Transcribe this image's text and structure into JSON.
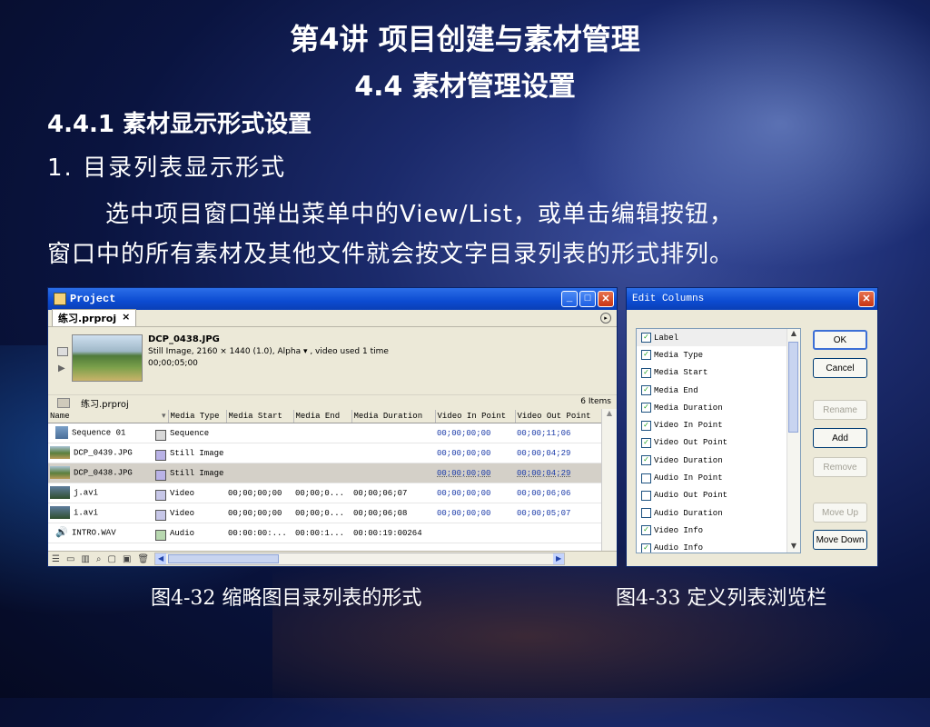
{
  "slide": {
    "title": "第4讲  项目创建与素材管理",
    "subtitle": "4.4 素材管理设置",
    "section": "4.4.1 素材显示形式设置",
    "item": "1. 目录列表显示形式",
    "paragraph_line1": "选中项目窗口弹出菜单中的View/List，或单击编辑按钮，",
    "paragraph_line2": "窗口中的所有素材及其他文件就会按文字目录列表的形式排列。",
    "caption_left": "图4-32 缩略图目录列表的形式",
    "caption_right": "图4-33 定义列表浏览栏"
  },
  "project_window": {
    "title": "Project",
    "tab_label": "练习.prproj",
    "tab_close": "×",
    "preview": {
      "name": "DCP_0438.JPG",
      "meta": "Still Image, 2160 × 1440 (1.0), Alpha  ▾  , video used 1 time",
      "duration": "00;00;05;00"
    },
    "folder_name": "练习.prproj",
    "item_count": "6 Items",
    "columns": [
      "Name",
      "Media Type",
      "Media Start",
      "Media End",
      "Media Duration",
      "Video In Point",
      "Video Out Point"
    ],
    "rows": [
      {
        "name": "Sequence 01",
        "icon": "sequence-icon",
        "label_color": "#d8d8d8",
        "type": "Sequence",
        "start": "",
        "end": "",
        "duration": "",
        "in": "00;00;00;00",
        "out": "00;00;11;06"
      },
      {
        "name": "DCP_0439.JPG",
        "icon": "photo-icon",
        "label_color": "#b9b2e6",
        "type": "Still Image",
        "start": "",
        "end": "",
        "duration": "",
        "in": "00;00;00;00",
        "out": "00;00;04;29"
      },
      {
        "name": "DCP_0438.JPG",
        "icon": "photo-icon",
        "label_color": "#b9b2e6",
        "type": "Still Image",
        "start": "",
        "end": "",
        "duration": "",
        "in": "00;00;00;00",
        "out": "00;00;04;29",
        "selected": true
      },
      {
        "name": "j.avi",
        "icon": "video-icon",
        "label_color": "#c7c7e8",
        "type": "Video",
        "start": "00;00;00;00",
        "end": "00;00;0...",
        "duration": "00;00;06;07",
        "in": "00;00;00;00",
        "out": "00;00;06;06"
      },
      {
        "name": "i.avi",
        "icon": "video-icon",
        "label_color": "#c7c7e8",
        "type": "Video",
        "start": "00;00;00;00",
        "end": "00;00;0...",
        "duration": "00;00;06;08",
        "in": "00;00;00;00",
        "out": "00;00;05;07"
      },
      {
        "name": "INTRO.WAV",
        "icon": "speaker-icon",
        "label_color": "#b8d8b0",
        "type": "Audio",
        "start": "00:00:00:...",
        "end": "00:00:1...",
        "duration": "00:00:19:00264",
        "in": "",
        "out": ""
      }
    ]
  },
  "edit_columns": {
    "title": "Edit Columns",
    "items": [
      {
        "label": "Label",
        "checked": true
      },
      {
        "label": "Media Type",
        "checked": true
      },
      {
        "label": "Media Start",
        "checked": true
      },
      {
        "label": "Media End",
        "checked": true
      },
      {
        "label": "Media Duration",
        "checked": true
      },
      {
        "label": "Video In Point",
        "checked": true
      },
      {
        "label": "Video Out Point",
        "checked": true
      },
      {
        "label": "Video Duration",
        "checked": true
      },
      {
        "label": "Audio In Point",
        "checked": false
      },
      {
        "label": "Audio Out Point",
        "checked": false
      },
      {
        "label": "Audio Duration",
        "checked": false
      },
      {
        "label": "Video Info",
        "checked": true
      },
      {
        "label": "Audio Info",
        "checked": true
      }
    ],
    "buttons": {
      "ok": "OK",
      "cancel": "Cancel",
      "rename": "Rename",
      "add": "Add",
      "remove": "Remove",
      "move_up": "Move Up",
      "move_down": "Move Down"
    }
  }
}
